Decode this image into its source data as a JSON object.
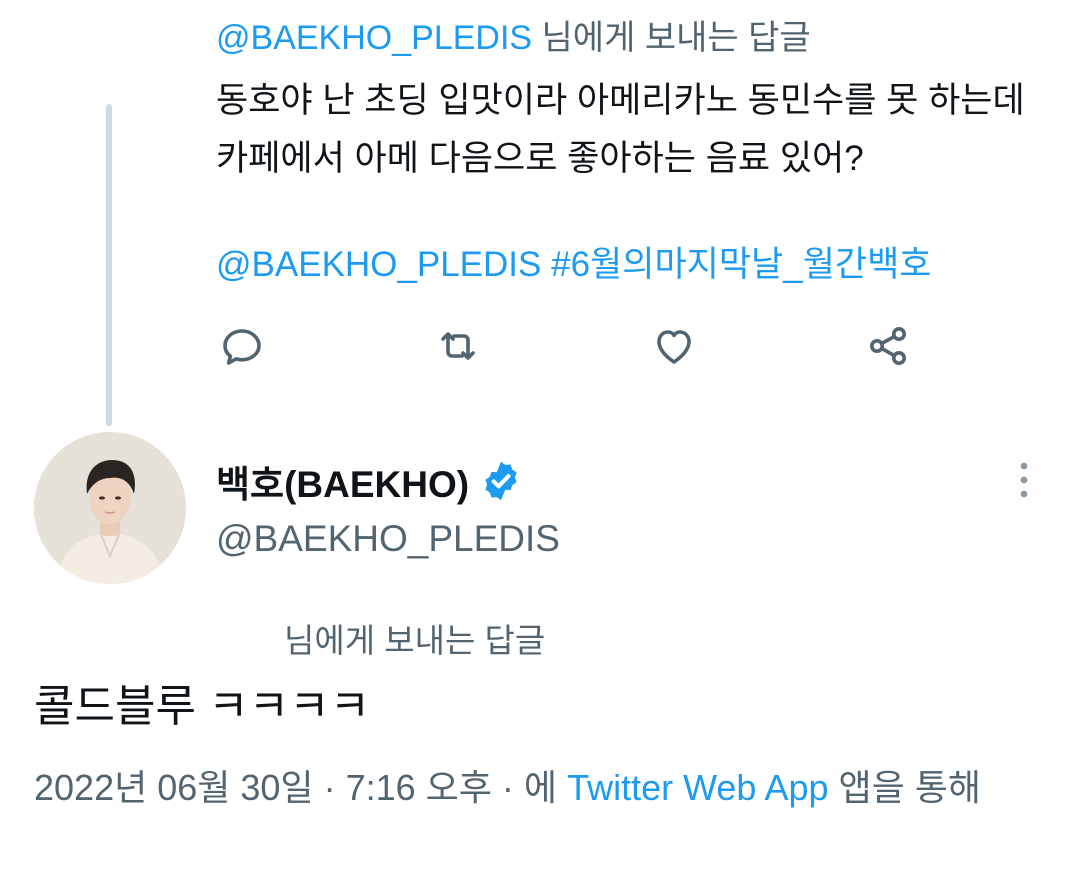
{
  "parent_tweet": {
    "reply_to_handle": "@BAEKHO_PLEDIS",
    "reply_to_suffix": "님에게 보내는 답글",
    "text_line1": "동호야 난 초딩 입맛이라 아메리카노 동민수를 못 하는데",
    "text_line2": "카페에서 아메 다음으로 좋아하는 음료 있어?",
    "mention": "@BAEKHO_PLEDIS",
    "hashtag": "#6월의마지막날_월간백호"
  },
  "actions": {
    "reply_icon": "reply-icon",
    "retweet_icon": "retweet-icon",
    "like_icon": "heart-icon",
    "share_icon": "share-icon"
  },
  "main_tweet": {
    "display_name": "백호(BAEKHO)",
    "handle": "@BAEKHO_PLEDIS",
    "reply_label": "님에게 보내는 답글",
    "text": "콜드블루 ㅋㅋㅋㅋ",
    "date": "2022년 06월 30일",
    "separator": "·",
    "time": "7:16 오후",
    "via_prefix": "에",
    "app": "Twitter Web App",
    "via_suffix": "앱을 통해"
  },
  "colors": {
    "accent": "#1d9bf0",
    "secondary_text": "#536471",
    "primary_text": "#0f1419",
    "thread_line": "#cfd9de"
  }
}
